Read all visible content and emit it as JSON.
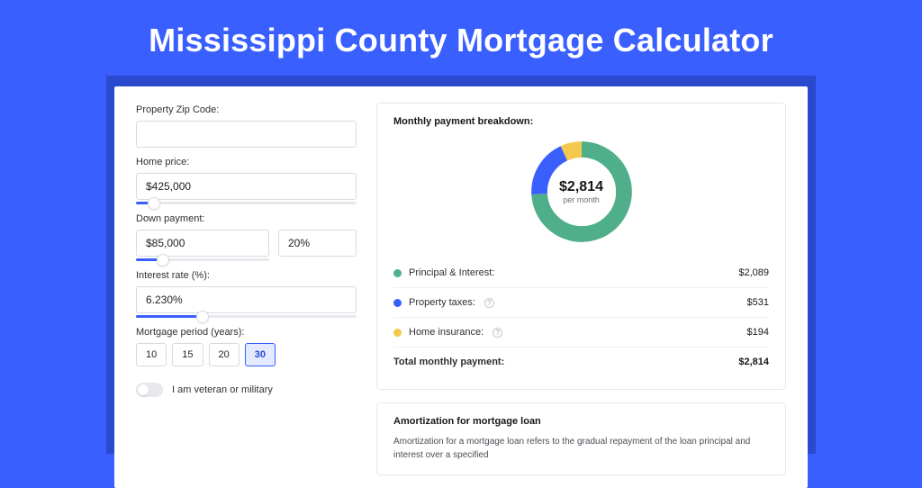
{
  "header": {
    "title": "Mississippi County Mortgage Calculator"
  },
  "form": {
    "zip": {
      "label": "Property Zip Code:",
      "value": ""
    },
    "home_price": {
      "label": "Home price:",
      "value": "$425,000",
      "slider_pct": 8
    },
    "down_payment": {
      "label": "Down payment:",
      "amount": "$85,000",
      "pct": "20%",
      "slider_pct": 20
    },
    "interest": {
      "label": "Interest rate (%):",
      "value": "6.230%",
      "slider_pct": 30
    },
    "period": {
      "label": "Mortgage period (years):",
      "options": [
        "10",
        "15",
        "20",
        "30"
      ],
      "selected": "30"
    },
    "veteran": {
      "label": "I am veteran or military",
      "on": false
    }
  },
  "breakdown": {
    "title": "Monthly payment breakdown:",
    "donut": {
      "value": "$2,814",
      "sub": "per month"
    },
    "items": [
      {
        "label": "Principal & Interest:",
        "amount": "$2,089",
        "color": "#4faf8a"
      },
      {
        "label": "Property taxes:",
        "amount": "$531",
        "color": "#3a5fff",
        "help": true
      },
      {
        "label": "Home insurance:",
        "amount": "$194",
        "color": "#f2c94c",
        "help": true
      }
    ],
    "total": {
      "label": "Total monthly payment:",
      "amount": "$2,814"
    }
  },
  "amortization": {
    "title": "Amortization for mortgage loan",
    "body": "Amortization for a mortgage loan refers to the gradual repayment of the loan principal and interest over a specified"
  }
}
